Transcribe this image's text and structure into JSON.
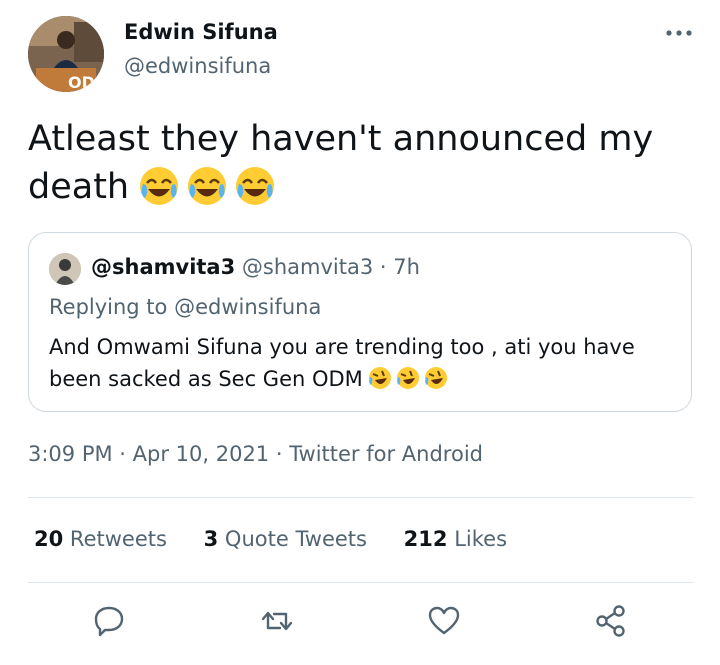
{
  "author": {
    "display_name": "Edwin Sifuna",
    "handle": "@edwinsifuna",
    "avatar_icon": "profile-photo"
  },
  "tweet": {
    "text": "Atleast they haven't announced my death"
  },
  "quoted_tweet": {
    "display_name": "@shamvita3",
    "handle": "@shamvita3",
    "time_ago": "· 7h",
    "replying_label": "Replying to",
    "replying_to": "@edwinsifuna",
    "text": "And Omwami Sifuna you are trending too , ati you have been sacked as Sec Gen ODM"
  },
  "meta": {
    "timestamp": "3:09 PM · Apr 10, 2021 · Twitter for Android"
  },
  "stats": {
    "retweets_count": "20",
    "retweets_label": "Retweets",
    "quotes_count": "3",
    "quotes_label": "Quote Tweets",
    "likes_count": "212",
    "likes_label": "Likes"
  },
  "colors": {
    "text": "#0f1419",
    "secondary": "#536471",
    "border": "#cfd9de",
    "divider": "#e1e8ed"
  }
}
